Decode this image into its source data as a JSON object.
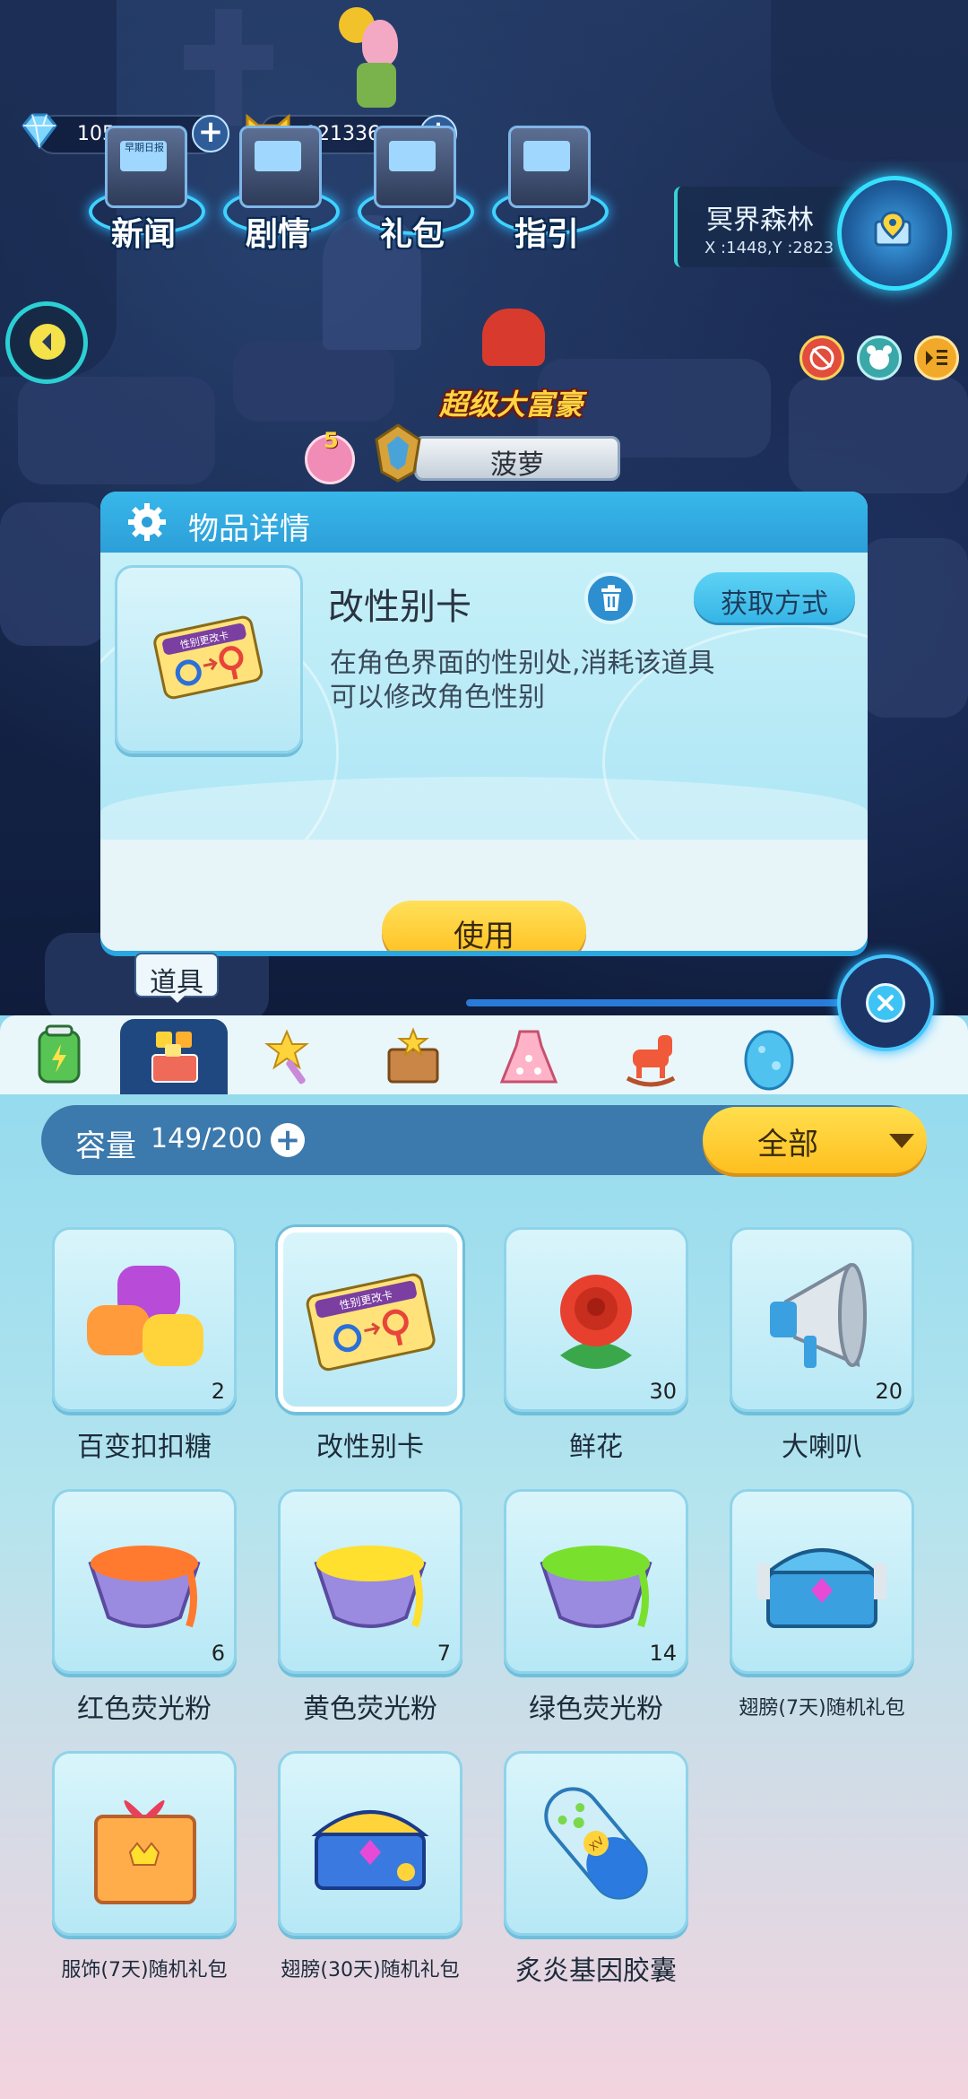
{
  "currency": {
    "diamonds": "105",
    "coins": "121336"
  },
  "top_menu": {
    "items": [
      {
        "label": "新闻",
        "screen": "早期日报"
      },
      {
        "label": "剧情"
      },
      {
        "label": "礼包"
      },
      {
        "label": "指引"
      }
    ]
  },
  "location": {
    "name": "冥界森林",
    "coords": "X :1448,Y :2823"
  },
  "player": {
    "title": "超级大富豪",
    "name": "菠萝",
    "level": "5"
  },
  "detail": {
    "header": "物品详情",
    "item_name": "改性别卡",
    "card_text": "性别更改卡",
    "description_line1": "在角色界面的性别处,消耗该道具",
    "description_line2": "可以修改角色性别",
    "obtain_label": "获取方式",
    "use_label": "使用"
  },
  "tab_tooltip": "道具",
  "capacity": {
    "label": "容量",
    "value": "149/200"
  },
  "filter": {
    "selected": "全部"
  },
  "items": [
    {
      "name": "百变扣扣糖",
      "count": "2"
    },
    {
      "name": "改性别卡",
      "count": "",
      "card_text": "性别更改卡"
    },
    {
      "name": "鲜花",
      "count": "30"
    },
    {
      "name": "大喇叭",
      "count": "20"
    },
    {
      "name": "红色荧光粉",
      "count": "6"
    },
    {
      "name": "黄色荧光粉",
      "count": "7"
    },
    {
      "name": "绿色荧光粉",
      "count": "14"
    },
    {
      "name": "翅膀(7天)随机礼包",
      "count": ""
    },
    {
      "name": "服饰(7天)随机礼包",
      "count": ""
    },
    {
      "name": "翅膀(30天)随机礼包",
      "count": ""
    },
    {
      "name": "炙炎基因胶囊",
      "count": ""
    }
  ],
  "capsule_text": "XV",
  "colors": {
    "accent_blue": "#2d9fd8",
    "use_button": "#ffc928",
    "filter_button": "#ffcb2d"
  }
}
